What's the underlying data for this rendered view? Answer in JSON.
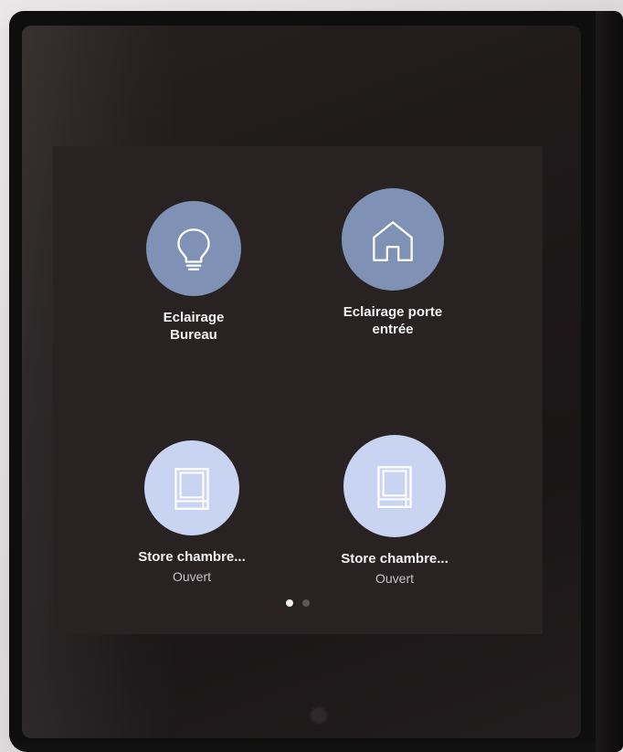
{
  "tiles": [
    {
      "label": "Eclairage\nBureau",
      "icon": "lightbulb-icon",
      "state": ""
    },
    {
      "label": "Eclairage  porte\nentrée",
      "icon": "house-icon",
      "state": ""
    },
    {
      "label": "Store chambre...",
      "icon": "window-blind-icon",
      "state": "Ouvert"
    },
    {
      "label": "Store chambre...",
      "icon": "window-blind-icon",
      "state": "Ouvert"
    }
  ],
  "pager": {
    "pages": 2,
    "active_page": 1
  },
  "colors": {
    "icon_stroke": "#ffffff",
    "tile_circle_lighting": "#7f92b5",
    "tile_circle_blind": "#c9d4f3",
    "screen_background": "#282223"
  }
}
